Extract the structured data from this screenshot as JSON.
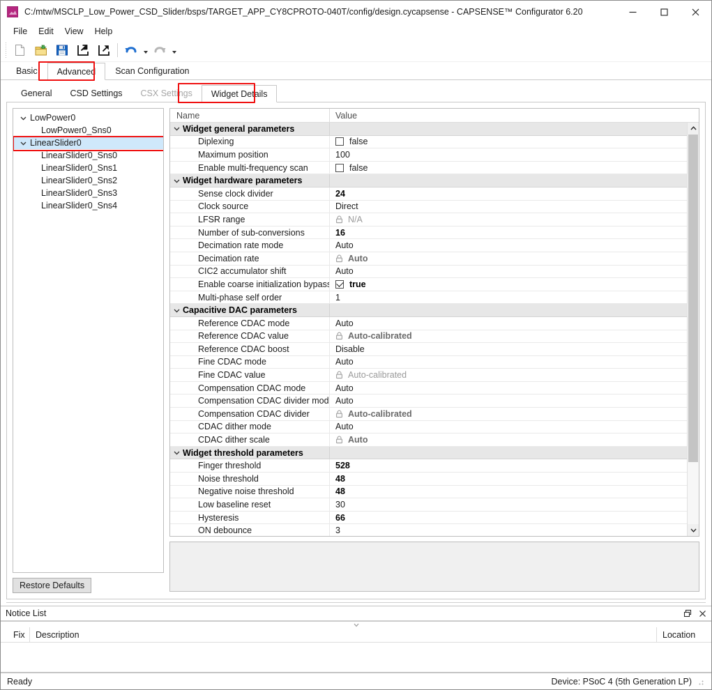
{
  "window": {
    "title": "C:/mtw/MSCLP_Low_Power_CSD_Slider/bsps/TARGET_APP_CY8CPROTO-040T/config/design.cycapsense - CAPSENSE™ Configurator 6.20",
    "minimize_label": "–",
    "maximize_label": "□",
    "close_label": "✕"
  },
  "menubar": {
    "items": [
      "File",
      "Edit",
      "View",
      "Help"
    ]
  },
  "toolbar": {
    "items": [
      {
        "name": "new-file-icon",
        "tooltip": "New"
      },
      {
        "name": "open-folder-icon",
        "tooltip": "Open"
      },
      {
        "name": "save-icon",
        "tooltip": "Save"
      },
      {
        "name": "import-icon",
        "tooltip": "Import"
      },
      {
        "name": "export-icon",
        "tooltip": "Export"
      },
      {
        "name": "undo-icon",
        "tooltip": "Undo"
      },
      {
        "name": "redo-icon",
        "tooltip": "Redo"
      }
    ]
  },
  "tabs": {
    "items": [
      {
        "label": "Basic",
        "selected": false
      },
      {
        "label": "Advanced",
        "selected": true,
        "highlighted": true
      },
      {
        "label": "Scan Configuration",
        "selected": false
      }
    ]
  },
  "subtabs": {
    "items": [
      {
        "label": "General",
        "selected": false,
        "disabled": false
      },
      {
        "label": "CSD Settings",
        "selected": false,
        "disabled": false
      },
      {
        "label": "CSX Settings",
        "selected": false,
        "disabled": true
      },
      {
        "label": "Widget Details",
        "selected": true,
        "disabled": false,
        "highlighted": true
      }
    ]
  },
  "tree": {
    "nodes": [
      {
        "label": "LowPower0",
        "level": 0,
        "expandable": true,
        "expanded": true,
        "selected": false
      },
      {
        "label": "LowPower0_Sns0",
        "level": 1,
        "expandable": false,
        "selected": false
      },
      {
        "label": "LinearSlider0",
        "level": 0,
        "expandable": true,
        "expanded": true,
        "selected": true,
        "highlighted": true
      },
      {
        "label": "LinearSlider0_Sns0",
        "level": 1,
        "expandable": false,
        "selected": false
      },
      {
        "label": "LinearSlider0_Sns1",
        "level": 1,
        "expandable": false,
        "selected": false
      },
      {
        "label": "LinearSlider0_Sns2",
        "level": 1,
        "expandable": false,
        "selected": false
      },
      {
        "label": "LinearSlider0_Sns3",
        "level": 1,
        "expandable": false,
        "selected": false
      },
      {
        "label": "LinearSlider0_Sns4",
        "level": 1,
        "expandable": false,
        "selected": false
      }
    ],
    "restore_defaults_label": "Restore Defaults"
  },
  "grid": {
    "columns": {
      "name": "Name",
      "value": "Value"
    },
    "rows": [
      {
        "type": "category",
        "name": "Widget general parameters",
        "expanded": true
      },
      {
        "type": "prop",
        "name": "Diplexing",
        "value": "false",
        "style": "checkbox",
        "checked": false
      },
      {
        "type": "prop",
        "name": "Maximum position",
        "value": "100",
        "style": "normal"
      },
      {
        "type": "prop",
        "name": "Enable multi-frequency scan",
        "value": "false",
        "style": "checkbox",
        "checked": false
      },
      {
        "type": "category",
        "name": "Widget hardware parameters",
        "expanded": true
      },
      {
        "type": "prop",
        "name": "Sense clock divider",
        "value": "24",
        "style": "bold"
      },
      {
        "type": "prop",
        "name": "Clock source",
        "value": "Direct",
        "style": "normal"
      },
      {
        "type": "prop",
        "name": "LFSR range",
        "value": "N/A",
        "style": "locked"
      },
      {
        "type": "prop",
        "name": "Number of sub-conversions",
        "value": "16",
        "style": "bold"
      },
      {
        "type": "prop",
        "name": "Decimation rate mode",
        "value": "Auto",
        "style": "normal"
      },
      {
        "type": "prop",
        "name": "Decimation rate",
        "value": "Auto",
        "style": "locked-bold"
      },
      {
        "type": "prop",
        "name": "CIC2 accumulator shift",
        "value": "Auto",
        "style": "normal"
      },
      {
        "type": "prop",
        "name": "Enable coarse initialization bypass",
        "value": "true",
        "style": "checkbox-bold",
        "checked": true
      },
      {
        "type": "prop",
        "name": "Multi-phase self order",
        "value": "1",
        "style": "normal"
      },
      {
        "type": "category",
        "name": "Capacitive DAC parameters",
        "expanded": true
      },
      {
        "type": "prop",
        "name": "Reference CDAC mode",
        "value": "Auto",
        "style": "normal"
      },
      {
        "type": "prop",
        "name": "Reference CDAC value",
        "value": "Auto-calibrated",
        "style": "locked-bold"
      },
      {
        "type": "prop",
        "name": "Reference CDAC boost",
        "value": "Disable",
        "style": "normal"
      },
      {
        "type": "prop",
        "name": "Fine CDAC mode",
        "value": "Auto",
        "style": "normal"
      },
      {
        "type": "prop",
        "name": "Fine CDAC value",
        "value": "Auto-calibrated",
        "style": "locked"
      },
      {
        "type": "prop",
        "name": "Compensation CDAC mode",
        "value": "Auto",
        "style": "normal"
      },
      {
        "type": "prop",
        "name": "Compensation CDAC divider mode",
        "value": "Auto",
        "style": "normal"
      },
      {
        "type": "prop",
        "name": "Compensation CDAC divider",
        "value": "Auto-calibrated",
        "style": "locked-bold"
      },
      {
        "type": "prop",
        "name": "CDAC dither mode",
        "value": "Auto",
        "style": "normal"
      },
      {
        "type": "prop",
        "name": "CDAC dither scale",
        "value": "Auto",
        "style": "locked-bold"
      },
      {
        "type": "category",
        "name": "Widget threshold parameters",
        "expanded": true
      },
      {
        "type": "prop",
        "name": "Finger threshold",
        "value": "528",
        "style": "bold"
      },
      {
        "type": "prop",
        "name": "Noise threshold",
        "value": "48",
        "style": "bold"
      },
      {
        "type": "prop",
        "name": "Negative noise threshold",
        "value": "48",
        "style": "bold"
      },
      {
        "type": "prop",
        "name": "Low baseline reset",
        "value": "30",
        "style": "normal"
      },
      {
        "type": "prop",
        "name": "Hysteresis",
        "value": "66",
        "style": "bold"
      },
      {
        "type": "prop",
        "name": "ON debounce",
        "value": "3",
        "style": "normal"
      }
    ],
    "scroll_thumb_percent": 84
  },
  "notice_list": {
    "title": "Notice List",
    "columns": {
      "fix": "Fix",
      "description": "Description",
      "location": "Location"
    },
    "rows": []
  },
  "statusbar": {
    "status": "Ready",
    "device": "Device: PSoC 4 (5th Generation LP)"
  },
  "colors": {
    "highlight_red": "#ef1010",
    "tree_selection": "#cfe8fb",
    "category_bg": "#e7e7e7",
    "accent_app_icon": "#b5277f"
  }
}
